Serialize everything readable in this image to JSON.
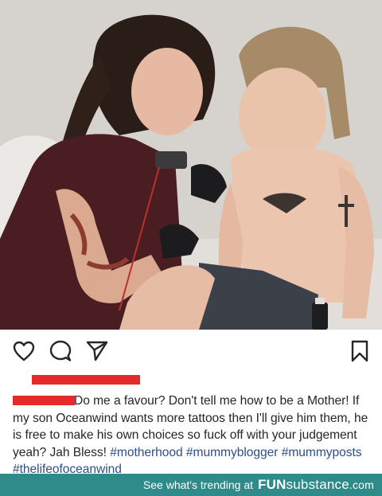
{
  "post": {
    "photo_alt": "",
    "actions": {
      "like_icon": "heart-icon",
      "comment_icon": "comment-bubble-icon",
      "share_icon": "send-arrow-icon",
      "save_icon": "bookmark-icon"
    },
    "caption": {
      "text": "Do me a favour? Don't tell me how to be a Mother! If my son Oceanwind wants more tattoos then I'll give him them, he is free to make his own choices so fuck off with your judgement yeah? Jah Bless!",
      "hashtags": [
        "#motherhood",
        "#mummyblogger",
        "#mummyposts",
        "#thelifeofoceanwind"
      ]
    },
    "colors": {
      "redaction": "#e52a2a",
      "hashtag": "#2b4f86",
      "banner_bg": "#2f8a8a"
    }
  },
  "banner": {
    "text": "See what's trending at",
    "brand_fun": "FUN",
    "brand_sub": "substance",
    "brand_com": ".com"
  }
}
